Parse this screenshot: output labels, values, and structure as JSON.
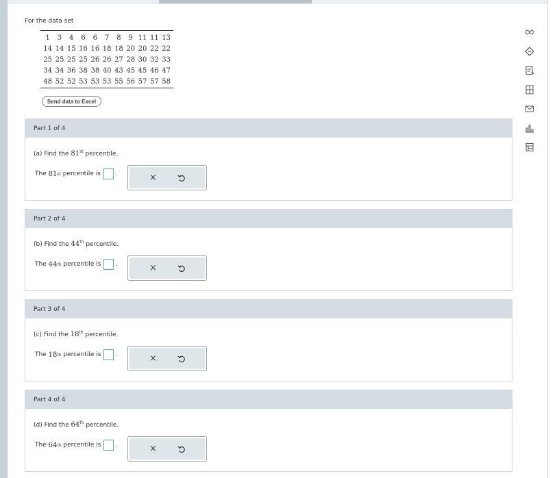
{
  "intro": "For the data set",
  "data_rows": [
    [
      "1",
      "3",
      "4",
      "6",
      "6",
      "7",
      "8",
      "9",
      "11",
      "11",
      "13"
    ],
    [
      "14",
      "14",
      "15",
      "16",
      "16",
      "18",
      "18",
      "20",
      "20",
      "22",
      "22"
    ],
    [
      "25",
      "25",
      "25",
      "25",
      "26",
      "26",
      "27",
      "28",
      "30",
      "32",
      "33"
    ],
    [
      "34",
      "34",
      "36",
      "38",
      "38",
      "40",
      "43",
      "45",
      "45",
      "46",
      "47"
    ],
    [
      "48",
      "52",
      "52",
      "53",
      "53",
      "53",
      "55",
      "56",
      "57",
      "57",
      "58"
    ]
  ],
  "excel_button": "Send data to Excel",
  "parts": [
    {
      "header": "Part 1 of 4",
      "q_prefix": "(a) Find the",
      "num": "81",
      "sup": "st",
      "q_suffix": "percentile.",
      "a_prefix": "The",
      "a_suffix": "percentile is",
      "period": "."
    },
    {
      "header": "Part 2 of 4",
      "q_prefix": "(b) Find the",
      "num": "44",
      "sup": "th",
      "q_suffix": "percentile.",
      "a_prefix": "The",
      "a_suffix": "percentile is",
      "period": "."
    },
    {
      "header": "Part 3 of 4",
      "q_prefix": "(c) Find the",
      "num": "18",
      "sup": "th",
      "q_suffix": "percentile.",
      "a_prefix": "The",
      "a_suffix": "percentile is",
      "period": "."
    },
    {
      "header": "Part 4 of 4",
      "q_prefix": "(d) Find the",
      "num": "64",
      "sup": "th",
      "q_suffix": "percentile.",
      "a_prefix": "The",
      "a_suffix": "percentile is",
      "period": "."
    }
  ],
  "tools": {
    "clear_icon": "x-icon",
    "undo_icon": "undo-icon",
    "clear_glyph": "×"
  },
  "sidebar": [
    "infinity-icon",
    "eraser-icon",
    "notes-icon",
    "calculator-icon",
    "mail-icon",
    "chart-icon",
    "table-icon"
  ],
  "colors": {
    "header_bg": "#d5dde2",
    "input_border": "#5aa9d6",
    "tool_bg": "#dfe6ea"
  }
}
